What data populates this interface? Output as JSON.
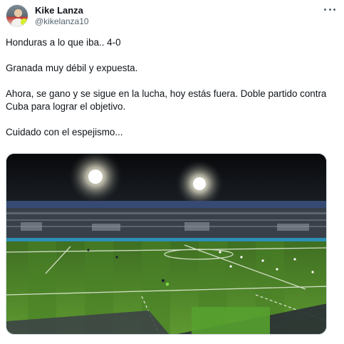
{
  "tweet": {
    "author": {
      "name": "Kike Lanza",
      "handle": "@kikelanza10"
    },
    "paragraphs": [
      "Honduras a lo que iba.. 4-0",
      "Granada muy débil y expuesta.",
      "Ahora, se gano y se sigue en la lucha, hoy estás fuera. Doble partido contra Cuba para lograr el objetivo.",
      "Cuidado con el espejismo..."
    ],
    "media": {
      "icon": "stadium-photo"
    }
  },
  "colors": {
    "text": "#0f1419",
    "secondary": "#536471",
    "pitch": "#4f8a2a",
    "border": "#cfd9de"
  }
}
